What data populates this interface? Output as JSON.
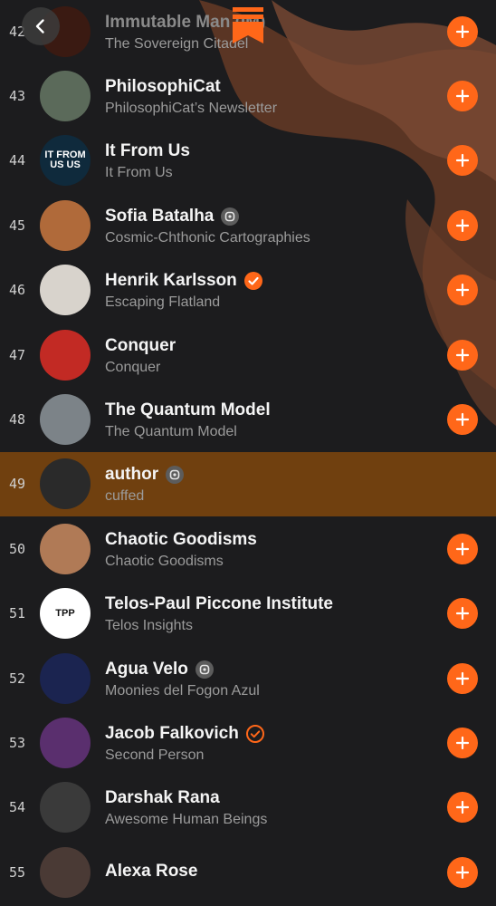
{
  "colors": {
    "accent": "#ff6719",
    "highlight_row": "#70400f",
    "background": "#1c1c1e"
  },
  "header": {
    "back_icon": "chevron-left-icon",
    "logo_icon": "substack-logo-icon"
  },
  "rows": [
    {
      "rank": "42",
      "name": "Immutable Man (IM)",
      "sub": "The Sovereign Citadel",
      "badge": "",
      "avatar_color": "#3a1a12",
      "avatar_text": "",
      "subscribed": false
    },
    {
      "rank": "43",
      "name": "PhilosophiCat",
      "sub": "PhilosophiCat’s Newsletter",
      "badge": "",
      "avatar_color": "#5b6a5a",
      "avatar_text": "",
      "subscribed": false
    },
    {
      "rank": "44",
      "name": "It From Us",
      "sub": "It From Us",
      "badge": "",
      "avatar_color": "#0f2a3c",
      "avatar_text": "IT FROM US US",
      "subscribed": false
    },
    {
      "rank": "45",
      "name": "Sofia Batalha",
      "sub": "Cosmic-Chthonic Cartographies",
      "badge": "bestseller",
      "avatar_color": "#b06a3a",
      "avatar_text": "",
      "subscribed": false
    },
    {
      "rank": "46",
      "name": "Henrik Karlsson",
      "sub": "Escaping Flatland",
      "badge": "verified",
      "avatar_color": "#d8d3cc",
      "avatar_text": "",
      "subscribed": false
    },
    {
      "rank": "47",
      "name": "Conquer",
      "sub": "Conquer",
      "badge": "",
      "avatar_color": "#c22a24",
      "avatar_text": "",
      "subscribed": false
    },
    {
      "rank": "48",
      "name": "The Quantum Model",
      "sub": "The Quantum Model",
      "badge": "",
      "avatar_color": "#7c8388",
      "avatar_text": "",
      "subscribed": false
    },
    {
      "rank": "49",
      "name": "author",
      "sub": "cuffed",
      "badge": "bestseller",
      "avatar_color": "#2a2a2a",
      "avatar_text": "",
      "subscribed": true
    },
    {
      "rank": "50",
      "name": "Chaotic Goodisms",
      "sub": "Chaotic Goodisms",
      "badge": "",
      "avatar_color": "#b07a56",
      "avatar_text": "",
      "subscribed": false
    },
    {
      "rank": "51",
      "name": "Telos-Paul Piccone Institute",
      "sub": "Telos Insights",
      "badge": "",
      "avatar_color": "#ffffff",
      "avatar_text": "TPP",
      "subscribed": false
    },
    {
      "rank": "52",
      "name": "Agua Velo",
      "sub": "Moonies del Fogon Azul",
      "badge": "bestseller",
      "avatar_color": "#1b2450",
      "avatar_text": "",
      "subscribed": false
    },
    {
      "rank": "53",
      "name": "Jacob Falkovich",
      "sub": "Second Person",
      "badge": "verified-outline",
      "avatar_color": "#5a2f6e",
      "avatar_text": "",
      "subscribed": false
    },
    {
      "rank": "54",
      "name": "Darshak Rana",
      "sub": "Awesome Human Beings",
      "badge": "",
      "avatar_color": "#3a3a3a",
      "avatar_text": "",
      "subscribed": false
    },
    {
      "rank": "55",
      "name": "Alexa Rose",
      "sub": "",
      "badge": "",
      "avatar_color": "#4a3a35",
      "avatar_text": "",
      "subscribed": false
    }
  ]
}
